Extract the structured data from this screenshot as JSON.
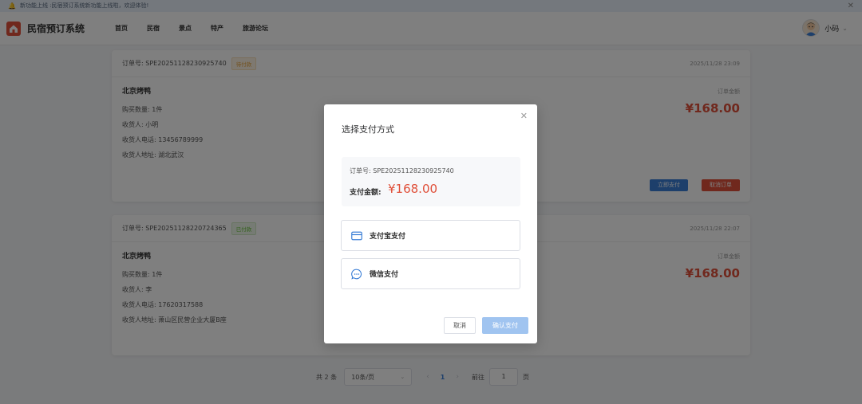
{
  "notice": {
    "text": "新功能上线  :民宿预订系统新功能上线啦，欢迎体验!"
  },
  "header": {
    "logo_text": "民宿预订系统",
    "nav": [
      "首页",
      "民宿",
      "景点",
      "特产",
      "旅游论坛"
    ],
    "user_name": "小码"
  },
  "orders": [
    {
      "order_no": "订单号: SPE20251128230925740",
      "status": "待付款",
      "time": "2025/11/28 23:09",
      "product": "北京烤鸭",
      "qty": "购买数量: 1件",
      "receiver": "收货人: 小明",
      "phone": "收货人电话: 13456789999",
      "address": "收货人地址: 湖北武汉",
      "amount_label": "订单金额",
      "amount": "¥168.00",
      "pay_label": "立即支付",
      "cancel_label": "取消订单"
    },
    {
      "order_no": "订单号: SPE20251128220724365",
      "status": "已付款",
      "time": "2025/11/28 22:07",
      "product": "北京烤鸭",
      "qty": "购买数量: 1件",
      "receiver": "收货人: 李",
      "phone": "收货人电话: 17620317588",
      "address": "收货人地址: 萧山区民营企业大厦B座",
      "amount_label": "订单金额",
      "amount": "¥168.00"
    }
  ],
  "pagination": {
    "total": "共 2 条",
    "page_size": "10条/页",
    "prev": "‹",
    "current": "1",
    "next": "›",
    "goto": "前往",
    "goto_value": "1",
    "goto_suffix": "页"
  },
  "dialog": {
    "title": "选择支付方式",
    "order_no": "订单号: SPE20251128230925740",
    "amount_label": "支付金额:",
    "amount": "¥168.00",
    "options": [
      "支付宝支付",
      "微信支付"
    ],
    "cancel": "取消",
    "confirm": "确认支付"
  },
  "icons": {
    "notice": "bell-icon",
    "close": "close-icon",
    "logo": "house-icon",
    "avatar": "avatar-icon",
    "caret": "chevron-down-icon",
    "alipay": "card-icon",
    "wechat": "chat-bubble-icon"
  },
  "colors": {
    "accent": "#3b7fd6",
    "price": "#e0503a",
    "pending": "#e6a23c",
    "paid": "#67c23a"
  }
}
